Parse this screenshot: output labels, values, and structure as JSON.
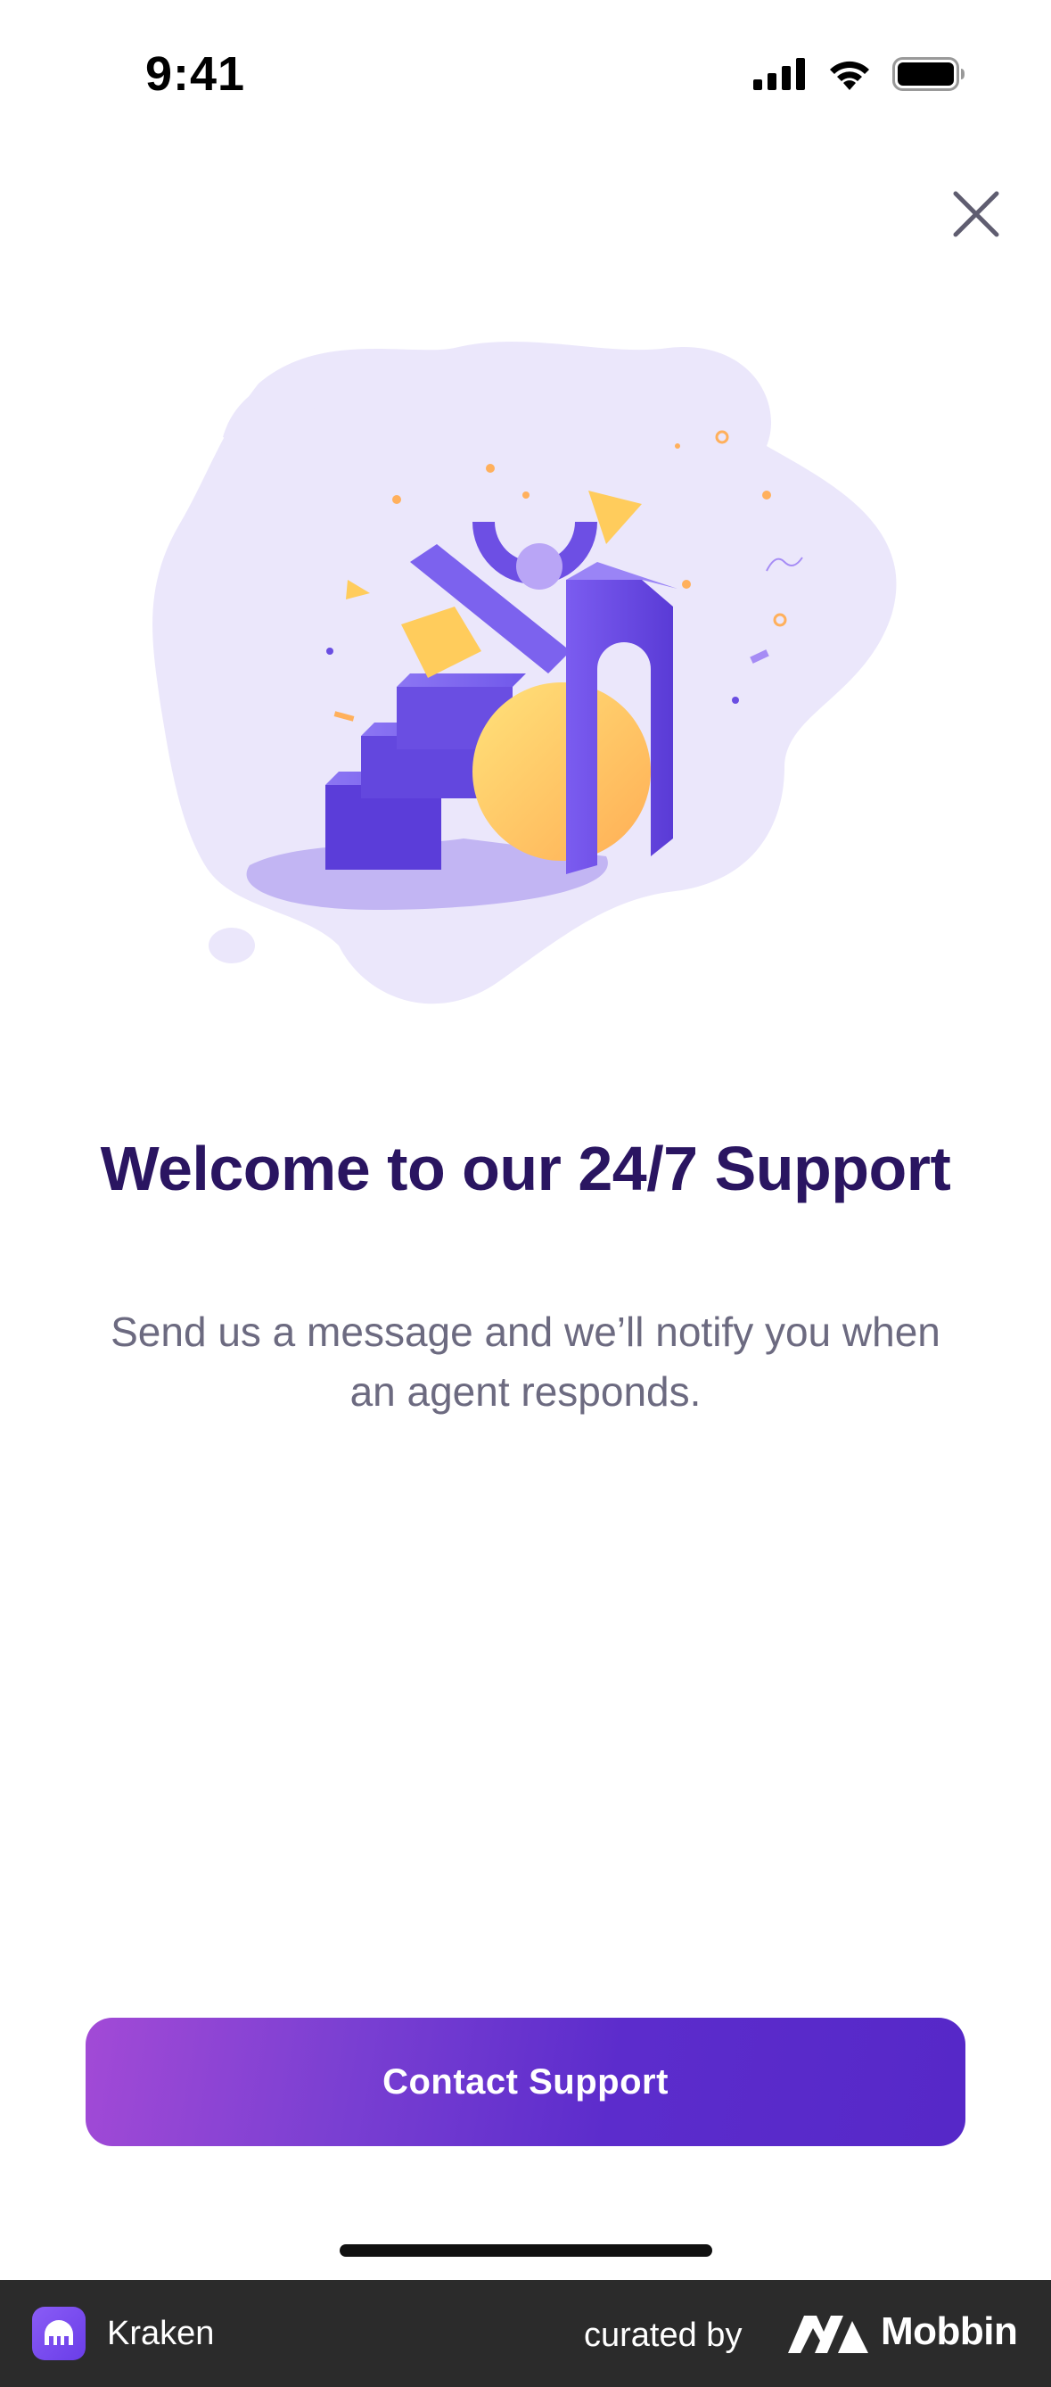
{
  "status_bar": {
    "time": "9:41",
    "signal_icon": "cellular-signal-icon",
    "wifi_icon": "wifi-icon",
    "battery_icon": "battery-icon"
  },
  "header": {
    "close_icon": "close-icon"
  },
  "illustration": {
    "icon": "support-stairs-illustration"
  },
  "content": {
    "title": "Welcome to our 24/7 Support",
    "subtitle": "Send us a message and we’ll notify you when an agent responds."
  },
  "actions": {
    "contact_label": "Contact Support"
  },
  "footer": {
    "app_name": "Kraken",
    "curated_by": "curated by",
    "source_name": "Mobbin"
  },
  "colors": {
    "title": "#2a1561",
    "subtitle": "#6c6a80",
    "button_start": "#a24ad6",
    "button_end": "#5628c8",
    "blob": "#ebe7fb",
    "stairs": "#6a4be0",
    "sphere": "#ffc766"
  }
}
